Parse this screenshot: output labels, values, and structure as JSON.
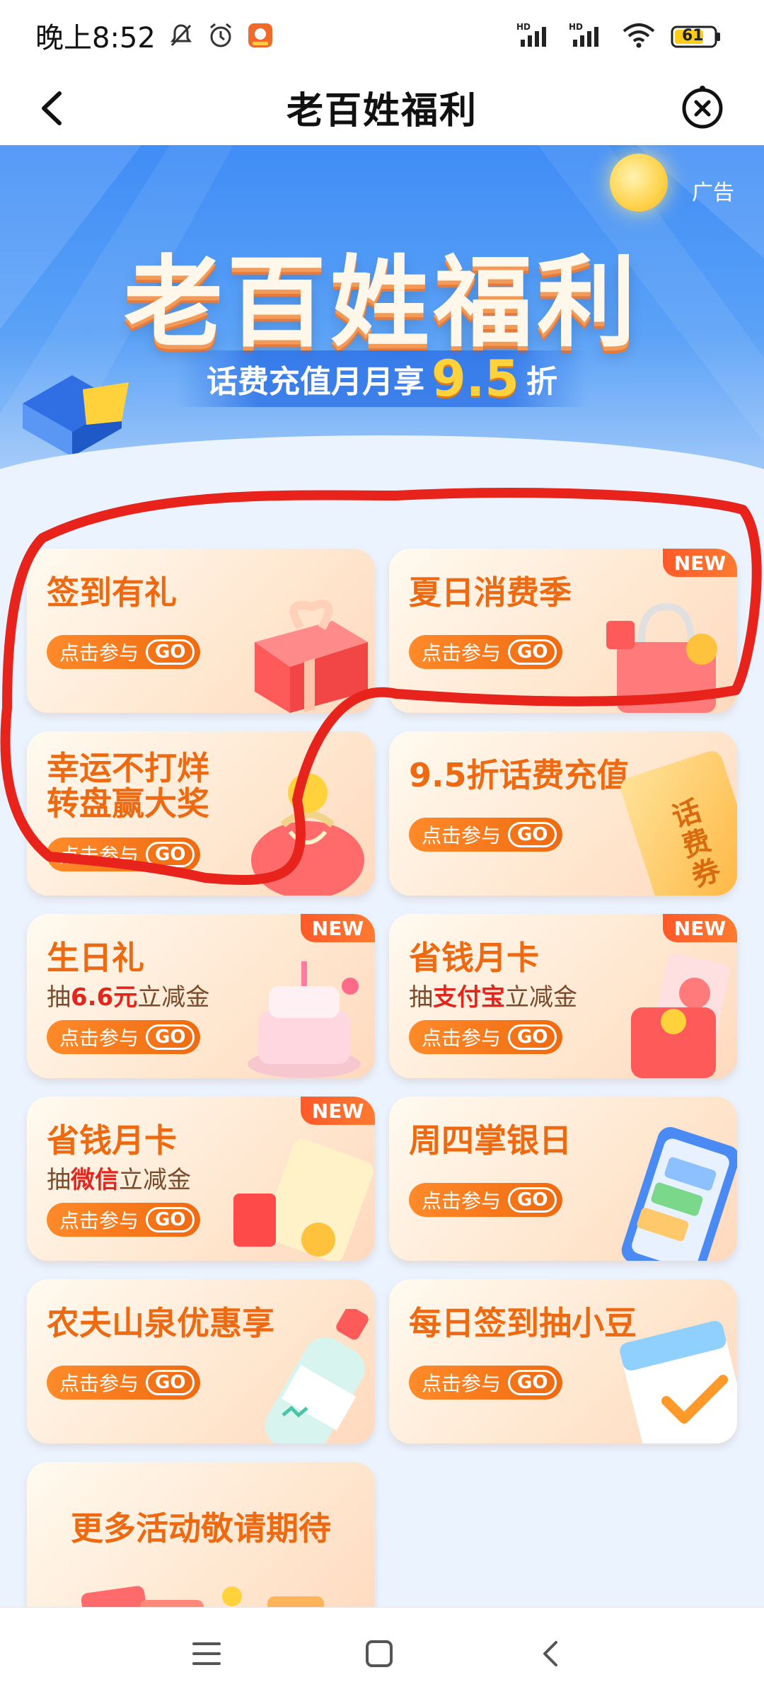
{
  "status_bar": {
    "time": "晚上8:52",
    "battery": "61",
    "signal_1": "HD",
    "signal_2": "HD"
  },
  "nav": {
    "title": "老百姓福利",
    "back_icon": "chevron-left-icon",
    "close_icon": "close-circle-icon"
  },
  "banner": {
    "ad_label": "广告",
    "title": "老百姓福利",
    "subtitle_pre": "话费充值月月享",
    "subtitle_num": "9.5",
    "subtitle_post": "折"
  },
  "cards": [
    {
      "title": "签到有礼",
      "button": "点击参与",
      "go": "GO"
    },
    {
      "title": "夏日消费季",
      "button": "点击参与",
      "go": "GO",
      "badge": "NEW"
    },
    {
      "title_line1": "幸运不打烊",
      "title_line2": "转盘赢大奖",
      "button": "点击参与",
      "go": "GO"
    },
    {
      "title": "9.5折话费充值",
      "button": "点击参与",
      "go": "GO",
      "art_text": "话费券"
    },
    {
      "title": "生日礼",
      "sub_pre": "抽",
      "sub_hl": "6.6元",
      "sub_post": "立减金",
      "button": "点击参与",
      "go": "GO",
      "badge": "NEW"
    },
    {
      "title": "省钱月卡",
      "sub_pre": "抽",
      "sub_hl": "支付宝",
      "sub_post": "立减金",
      "button": "点击参与",
      "go": "GO",
      "badge": "NEW"
    },
    {
      "title": "省钱月卡",
      "sub_pre": "抽",
      "sub_hl": "微信",
      "sub_post": "立减金",
      "button": "点击参与",
      "go": "GO",
      "badge": "NEW"
    },
    {
      "title": "周四掌银日",
      "button": "点击参与",
      "go": "GO"
    },
    {
      "title": "农夫山泉优惠享",
      "button": "点击参与",
      "go": "GO"
    },
    {
      "title": "每日签到抽小豆",
      "button": "点击参与",
      "go": "GO"
    },
    {
      "title": "更多活动敬请期待"
    }
  ],
  "colors": {
    "accent_orange": "#ee6a12",
    "banner_blue": "#3f8df6",
    "page_bg": "#eaf3ff",
    "marker_red": "#e8231b"
  }
}
